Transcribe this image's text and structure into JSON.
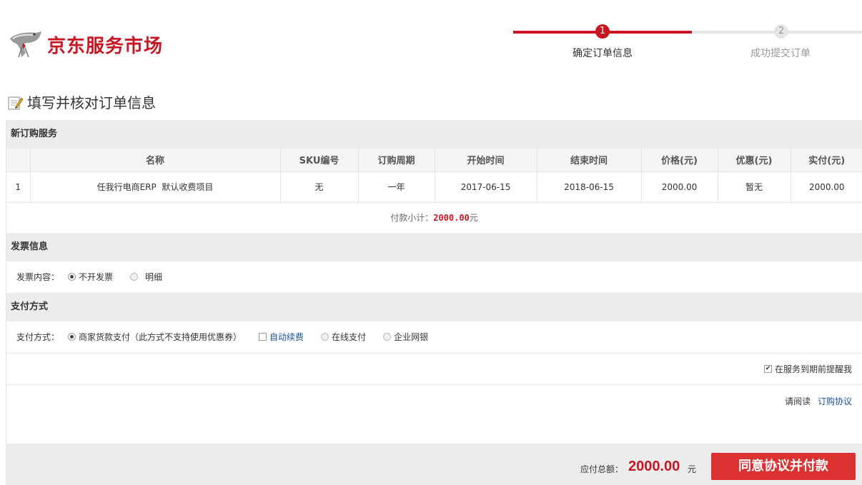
{
  "header": {
    "logo_text": "京东服务市场",
    "steps": [
      {
        "number": "1",
        "label": "确定订单信息"
      },
      {
        "number": "2",
        "label": "成功提交订单"
      }
    ]
  },
  "page_title": "填写并核对订单信息",
  "order_section": {
    "title": "新订购服务",
    "columns": [
      "",
      "名称",
      "SKU编号",
      "订购周期",
      "开始时间",
      "结束时间",
      "价格(元)",
      "优惠(元)",
      "实付(元)"
    ],
    "rows": [
      {
        "index": "1",
        "name": "任我行电商ERP  默认收费项目",
        "sku": "无",
        "period": "一年",
        "start": "2017-06-15",
        "end": "2018-06-15",
        "price": "2000.00",
        "discount": "暂无",
        "paid": "2000.00"
      }
    ],
    "subtotal_label": "付款小计：",
    "subtotal_amount": "2000.00",
    "subtotal_unit": "元"
  },
  "invoice_section": {
    "title": "发票信息",
    "label": "发票内容：",
    "options": [
      "不开发票",
      "明细"
    ],
    "selected": "不开发票"
  },
  "payment_section": {
    "title": "支付方式",
    "label": "支付方式：",
    "option_merchant": "商家货款支付（此方式不支持使用优惠券）",
    "option_auto_renew": "自动续费",
    "option_online": "在线支付",
    "option_bank": "企业网银",
    "reminder_label": "在服务到期前提醒我",
    "agree_prefix": "请阅读",
    "agree_link": "订购协议"
  },
  "footer": {
    "total_label": "应付总额：",
    "total_amount": "2000.00",
    "total_unit": "元",
    "pay_button": "同意协议并付款"
  },
  "colors": {
    "brand_red": "#c81623",
    "button_red": "#db3131",
    "link_blue": "#1a4fa0",
    "section_gray": "#ececec"
  }
}
